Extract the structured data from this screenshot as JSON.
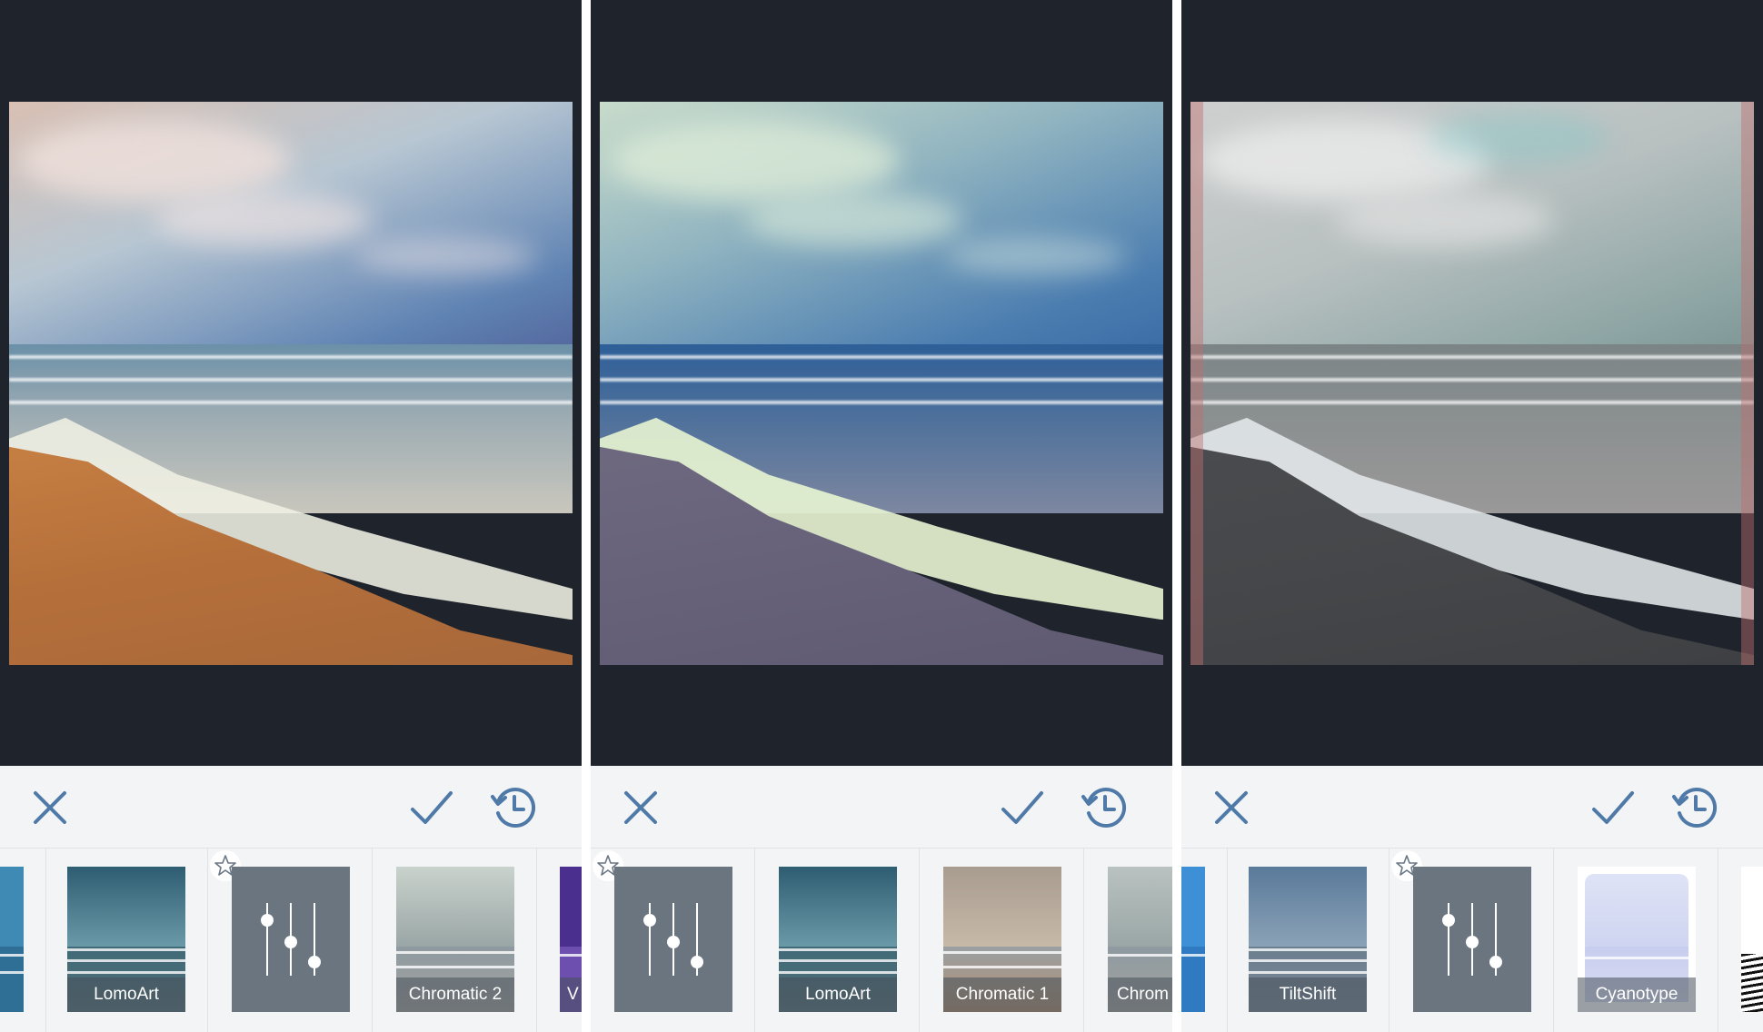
{
  "colors": {
    "viewer_bg": "#1e232c",
    "toolbar_bg": "#f3f4f6",
    "icon_blue": "#4f7aa8",
    "divider": "#dfe2e7"
  },
  "panels": [
    {
      "filter_style": "lomo",
      "toolbar": {
        "close_icon": "close-icon",
        "apply_icon": "checkmark-icon",
        "history_icon": "history-icon"
      },
      "tiles": [
        {
          "label": "",
          "kind": "photo",
          "style": "blue"
        },
        {
          "label": "LomoArt",
          "kind": "photo",
          "style": "teal"
        },
        {
          "label": "",
          "kind": "adjust",
          "favorite": true
        },
        {
          "label": "Chromatic 2",
          "kind": "photo",
          "style": "pale"
        },
        {
          "label": "V",
          "kind": "photo",
          "style": "purple"
        }
      ]
    },
    {
      "filter_style": "cool",
      "toolbar": {
        "close_icon": "close-icon",
        "apply_icon": "checkmark-icon",
        "history_icon": "history-icon"
      },
      "tiles": [
        {
          "label": "",
          "kind": "adjust",
          "favorite": true
        },
        {
          "label": "LomoArt",
          "kind": "photo",
          "style": "teal"
        },
        {
          "label": "Chromatic 1",
          "kind": "photo",
          "style": "warm"
        },
        {
          "label": "Chrom",
          "kind": "photo",
          "style": "pale"
        }
      ]
    },
    {
      "filter_style": "chromatic",
      "toolbar": {
        "close_icon": "close-icon",
        "apply_icon": "checkmark-icon",
        "history_icon": "history-icon"
      },
      "tiles": [
        {
          "label": "",
          "kind": "photo",
          "style": "blue"
        },
        {
          "label": "TiltShift",
          "kind": "photo",
          "style": "tilt"
        },
        {
          "label": "",
          "kind": "adjust",
          "favorite": true
        },
        {
          "label": "Cyanotype",
          "kind": "photo",
          "style": "cyan"
        },
        {
          "label": "",
          "kind": "photo",
          "style": "bw"
        }
      ]
    }
  ]
}
